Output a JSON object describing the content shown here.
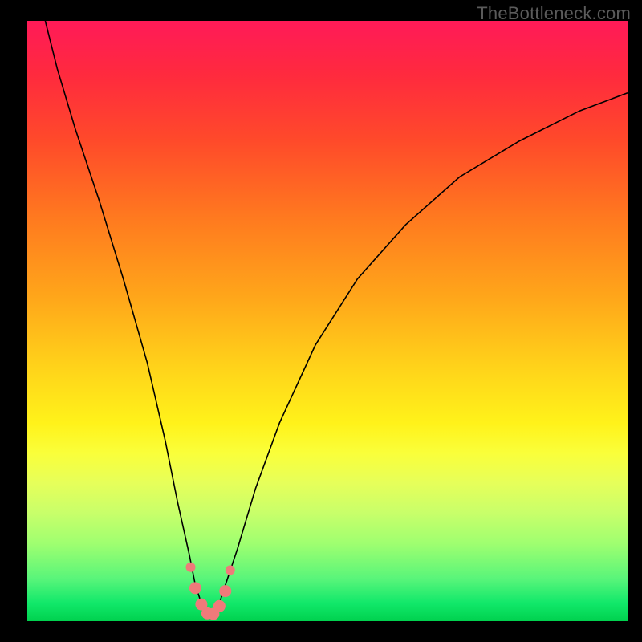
{
  "watermark": "TheBottleneck.com",
  "chart_data": {
    "type": "line",
    "title": "",
    "xlabel": "",
    "ylabel": "",
    "x_range": [
      0,
      100
    ],
    "y_range": [
      0,
      100
    ],
    "series": [
      {
        "name": "bottleneck-curve",
        "x": [
          3,
          5,
          8,
          12,
          16,
          20,
          23,
          25,
          27,
          28,
          29,
          30,
          31,
          32,
          33,
          35,
          38,
          42,
          48,
          55,
          63,
          72,
          82,
          92,
          100
        ],
        "y": [
          100,
          92,
          82,
          70,
          57,
          43,
          30,
          20,
          11,
          6,
          3,
          1,
          1,
          3,
          6,
          12,
          22,
          33,
          46,
          57,
          66,
          74,
          80,
          85,
          88
        ]
      }
    ],
    "markers": {
      "name": "minimum-points",
      "x": [
        27.2,
        28.0,
        29.0,
        30.0,
        31.0,
        32.0,
        33.0,
        33.8
      ],
      "y": [
        9.0,
        5.5,
        2.8,
        1.3,
        1.2,
        2.5,
        5.0,
        8.5
      ]
    },
    "background": {
      "type": "vertical-gradient",
      "top_color": "#ff1a58",
      "bottom_color": "#00d14e"
    }
  }
}
